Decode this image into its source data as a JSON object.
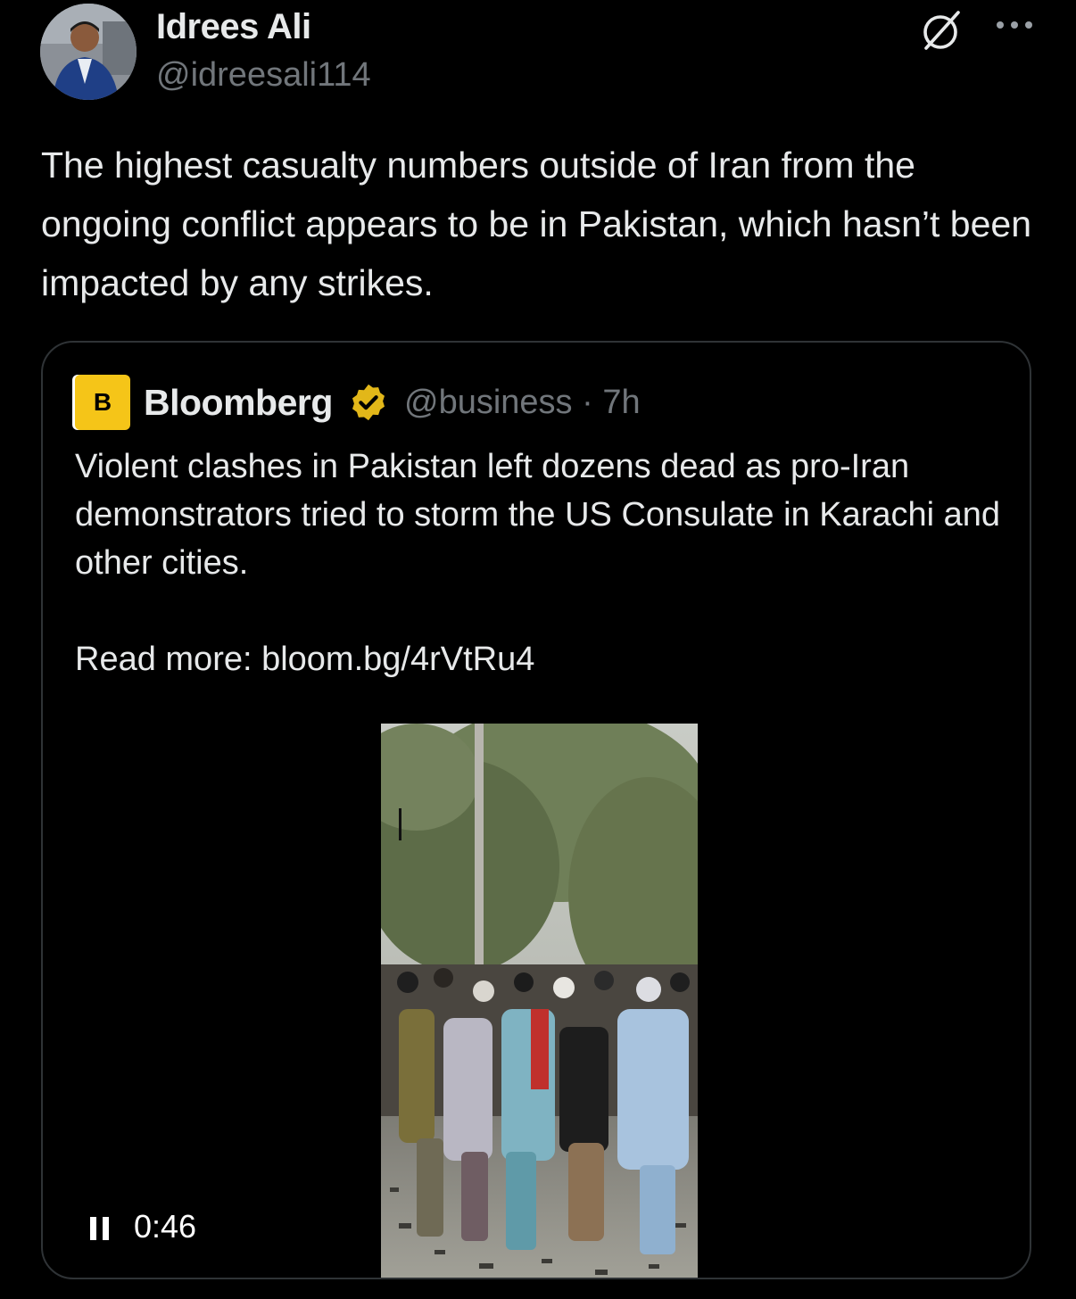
{
  "tweet": {
    "author_name": "Idrees Ali",
    "author_handle": "@idreesali114",
    "text": "The highest casualty numbers outside of Iran from the ongoing conflict appears to be in Pakistan, which hasn’t been impacted by any strikes.",
    "grok_icon": "grok-slash-circle-icon",
    "more_icon": "more-dots-icon"
  },
  "quote": {
    "logo_letter": "B",
    "author_name": "Bloomberg",
    "verified_icon": "verified-gold-badge-icon",
    "handle_time": "@business · 7h",
    "text": "Violent clashes in Pakistan left dozens dead as pro-Iran demonstrators tried to storm the US Consulate in Karachi and other cities.",
    "read_more": "Read more: bloom.bg/4rVtRu4",
    "video": {
      "time": "0:46",
      "control_icon": "pause-icon"
    }
  },
  "colors": {
    "background": "#000000",
    "text_primary": "#e7e9ea",
    "text_secondary": "#71767b",
    "border": "#2f3336",
    "bloomberg_yellow": "#f5c518",
    "verified_gold": "#e2b719"
  }
}
